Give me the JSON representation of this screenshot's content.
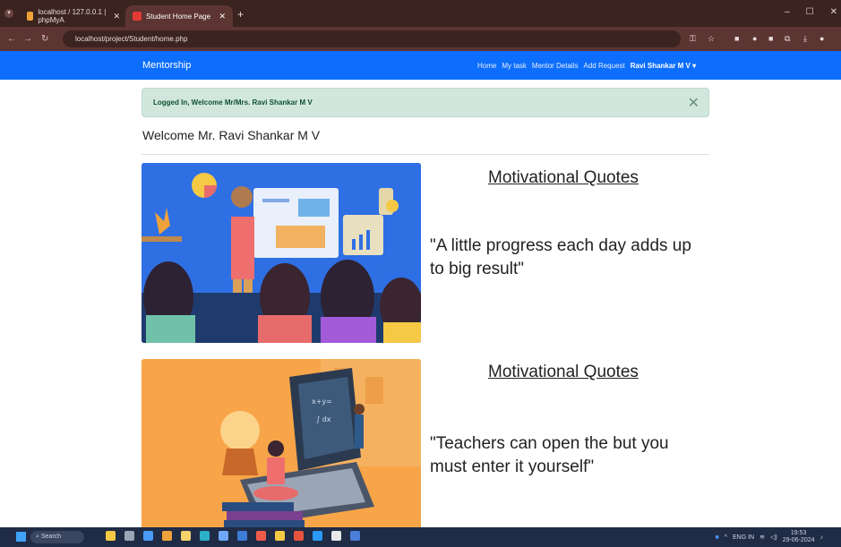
{
  "browser": {
    "tabs": [
      {
        "label": "localhost / 127.0.0.1 | phpMyA",
        "favicon_color": "#f0a23a"
      },
      {
        "label": "Student Home Page",
        "favicon_color": "#e53935"
      }
    ],
    "new_tab": "+",
    "url": "localhost/project/Student/home.php",
    "window_controls": [
      "–",
      "☐",
      "✕"
    ]
  },
  "navbar": {
    "brand": "Mentorship",
    "links": [
      "Home",
      "My task",
      "Mentor Details",
      "Add Request"
    ],
    "user": "Ravi Shankar M V ▾",
    "color": "#0d6efd"
  },
  "alert": {
    "text": "Logged In, Welcome Mr/Mrs. Ravi Shankar M V",
    "close": "✕"
  },
  "welcome": "Welcome Mr. Ravi Shankar M V",
  "quotes": [
    {
      "title": "Motivational Quotes",
      "text": "\"A little progress each day adds up to big result\""
    },
    {
      "title": "Motivational Quotes",
      "text": "\"Teachers can open the but you must enter it yourself\""
    }
  ],
  "taskbar": {
    "search": "Search",
    "lang": "ENG IN",
    "time": "19:53",
    "date": "29-06-2024"
  }
}
